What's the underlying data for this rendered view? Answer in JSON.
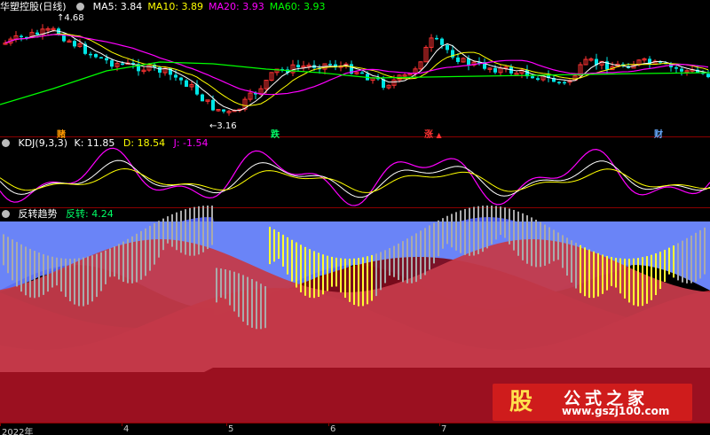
{
  "header": {
    "title": "华塑控股(日线)",
    "ma": [
      {
        "label": "MA5: 3.84",
        "color": "#ffffff"
      },
      {
        "label": "MA10: 3.89",
        "color": "#ffff00"
      },
      {
        "label": "MA20: 3.93",
        "color": "#ff00ff"
      },
      {
        "label": "MA60: 3.93",
        "color": "#00ff00"
      }
    ]
  },
  "kdj_header": {
    "name": "KDJ(9,3,3)",
    "k": "K: 11.85",
    "d": "D: 18.54",
    "j": "J: -1.54"
  },
  "trend_header": {
    "name": "反转趋势",
    "value": "反转: 4.24"
  },
  "annotations": {
    "high": "4.68",
    "low": "3.16",
    "signals": [
      {
        "text": "赌",
        "color": "#ff9900"
      },
      {
        "text": "跌",
        "color": "#00ff66"
      },
      {
        "text": "涨",
        "color": "#ff3333"
      },
      {
        "text": "财",
        "color": "#66aaff"
      }
    ]
  },
  "x_axis": {
    "labels": [
      "2022年",
      "4",
      "5",
      "6",
      "7"
    ]
  },
  "watermark": {
    "logo": "股",
    "cn": "公式之家",
    "url": "www.gszj100.com"
  },
  "chart_data": {
    "type": "candlestick",
    "panels": [
      "price",
      "kdj",
      "reversal-trend"
    ],
    "price": {
      "visible_high": 4.68,
      "visible_low": 3.16,
      "ma_last": {
        "MA5": 3.84,
        "MA10": 3.89,
        "MA20": 3.93,
        "MA60": 3.93
      },
      "series_colors": {
        "MA5": "#ffffff",
        "MA10": "#ffff00",
        "MA20": "#ff00ff",
        "MA60": "#00ff00",
        "up": "#ff3333",
        "down": "#00e5e5"
      }
    },
    "kdj": {
      "K": 11.85,
      "D": 18.54,
      "J": -1.54
    },
    "reversal": {
      "value": 4.24
    }
  }
}
